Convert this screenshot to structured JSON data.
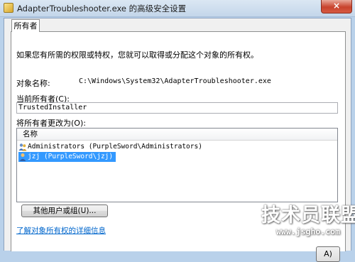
{
  "window": {
    "title": "AdapterTroubleshooter.exe 的高级安全设置",
    "close_label": "×"
  },
  "tabs": [
    {
      "label": "所有者",
      "active": true
    }
  ],
  "owner": {
    "intro": "如果您有所需的权限或特权，您就可以取得或分配这个对象的所有权。",
    "object_name_label": "对象名称:",
    "object_name_value": "C:\\Windows\\System32\\AdapterTroubleshooter.exe",
    "current_owner_label": "当前所有者(C):",
    "current_owner_value": "TrustedInstaller",
    "change_owner_label": "将所有者更改为(O):",
    "list_header": "名称",
    "candidates": [
      {
        "name": "Administrators (PurpleSword\\Administrators)",
        "icon": "group-icon",
        "selected": false
      },
      {
        "name": "jzj (PurpleSword\\jzj)",
        "icon": "user-icon",
        "selected": true
      }
    ],
    "other_users_button": "其他用户或组(U)...",
    "learn_more_link": "了解对象所有权的详细信息"
  },
  "footer": {
    "ok_stub": "A)"
  },
  "watermark": {
    "brand": "技术员联盟",
    "url": "www.jsgho.com"
  },
  "colors": {
    "selection": "#3399ff",
    "link": "#0066cc",
    "titlebar": "#c4d6ea"
  }
}
